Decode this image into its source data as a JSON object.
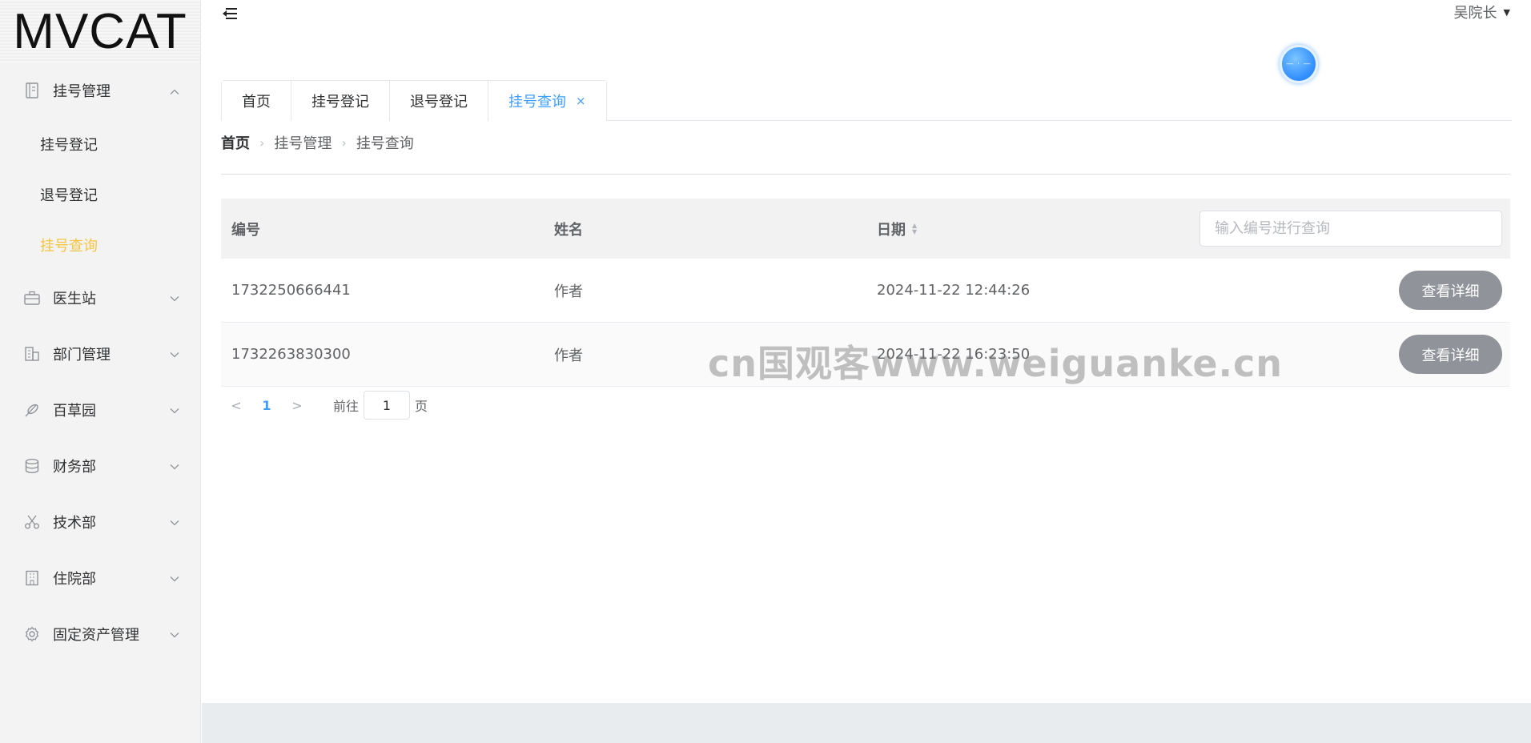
{
  "app": {
    "logo_text": "MVCAT",
    "user_name": "吴院长",
    "watermark": "cn国观客www.weiguanke.cn"
  },
  "sidebar": {
    "groups": [
      {
        "label": "挂号管理",
        "icon": "register-book-icon",
        "expanded": true,
        "items": [
          {
            "label": "挂号登记",
            "active": false
          },
          {
            "label": "退号登记",
            "active": false
          },
          {
            "label": "挂号查询",
            "active": true
          }
        ]
      },
      {
        "label": "医生站",
        "icon": "briefcase-icon",
        "expanded": false
      },
      {
        "label": "部门管理",
        "icon": "building-icon",
        "expanded": false
      },
      {
        "label": "百草园",
        "icon": "herb-icon",
        "expanded": false
      },
      {
        "label": "财务部",
        "icon": "database-coins-icon",
        "expanded": false
      },
      {
        "label": "技术部",
        "icon": "scissors-icon",
        "expanded": false
      },
      {
        "label": "住院部",
        "icon": "hospital-icon",
        "expanded": false
      },
      {
        "label": "固定资产管理",
        "icon": "gear-icon",
        "expanded": false
      }
    ],
    "active_color": "#f5c542"
  },
  "tabs": [
    {
      "label": "首页",
      "active": false
    },
    {
      "label": "挂号登记",
      "active": false
    },
    {
      "label": "退号登记",
      "active": false
    },
    {
      "label": "挂号查询",
      "active": true,
      "close": "×"
    }
  ],
  "breadcrumb": [
    "首页",
    "挂号管理",
    "挂号查询"
  ],
  "table": {
    "headers": {
      "id": "编号",
      "name": "姓名",
      "date": "日期"
    },
    "search_placeholder": "输入编号进行查询",
    "rows": [
      {
        "id": "1732250666441",
        "name": "作者",
        "date": "2024-11-22 12:44:26",
        "action": "查看详细"
      },
      {
        "id": "1732263830300",
        "name": "作者",
        "date": "2024-11-22 16:23:50",
        "action": "查看详细"
      }
    ]
  },
  "pagination": {
    "prev": "<",
    "current_page": "1",
    "next": ">",
    "goto_label": "前往",
    "goto_value": "1",
    "page_suffix": "页"
  },
  "colors": {
    "accent": "#409eff",
    "button_gray": "#909399"
  }
}
